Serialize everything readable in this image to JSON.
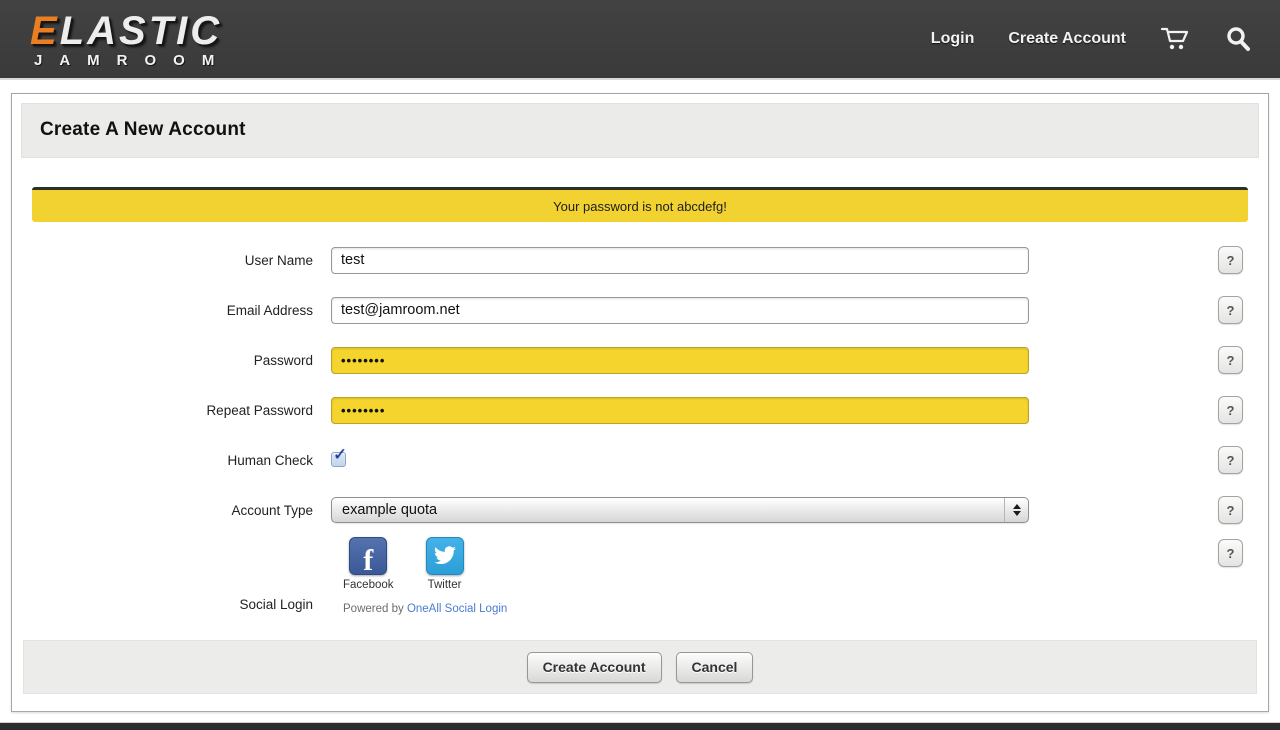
{
  "header": {
    "logo": {
      "brand_first_letter": "E",
      "brand_rest": "LASTIC",
      "brand_sub": "JAMROOM"
    },
    "nav": {
      "login_label": "Login",
      "create_account_label": "Create Account"
    },
    "icons": {
      "cart": "shopping-cart",
      "search": "magnifier"
    }
  },
  "page": {
    "title": "Create A New Account"
  },
  "alert": {
    "message": "Your password is not abcdefg!"
  },
  "form": {
    "help_label": "?",
    "fields": [
      {
        "label": "User Name",
        "type": "text",
        "value": "test"
      },
      {
        "label": "Email Address",
        "type": "text",
        "value": "test@jamroom.net"
      },
      {
        "label": "Password",
        "type": "password",
        "value": "••••••••"
      },
      {
        "label": "Repeat Password",
        "type": "password",
        "value": "••••••••"
      },
      {
        "label": "Human Check",
        "type": "checkbox",
        "checked": true,
        "check_glyph": "✓"
      },
      {
        "label": "Account Type",
        "type": "select",
        "value": "example quota"
      },
      {
        "label": "Social Login",
        "type": "social"
      }
    ]
  },
  "social": {
    "providers": [
      {
        "name": "Facebook",
        "glyph": "f"
      },
      {
        "name": "Twitter"
      }
    ],
    "powered_by_text": "Powered by",
    "powered_by_link": "OneAll Social Login"
  },
  "footer": {
    "submit_label": "Create Account",
    "cancel_label": "Cancel"
  },
  "colors": {
    "header_bg": "#3d3d3d",
    "logo_accent": "#ec7e22",
    "alert_yellow": "#f2d230",
    "password_field_yellow": "#f5d52d",
    "link_blue": "#4a7bd4",
    "facebook_blue": "#3b5998",
    "twitter_blue": "#2b9fd8"
  }
}
